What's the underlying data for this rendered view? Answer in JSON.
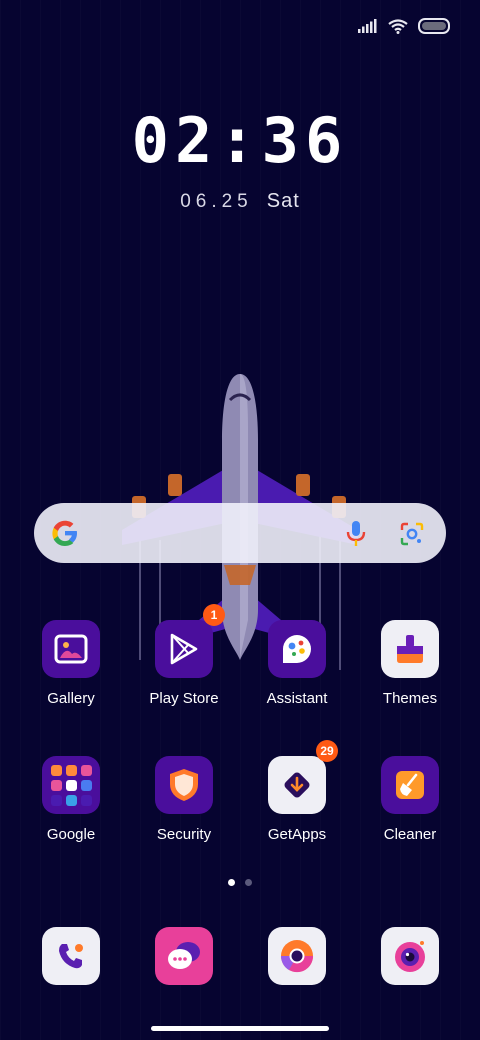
{
  "status_bar": {
    "signal_icon": "signal-bars-icon",
    "wifi_icon": "wifi-icon",
    "battery_icon": "battery-icon"
  },
  "lock": {
    "time": "02:36",
    "date": "06.25",
    "weekday": "Sat"
  },
  "search": {
    "logo_icon": "google-g-icon",
    "mic_icon": "microphone-icon",
    "lens_icon": "google-lens-icon"
  },
  "apps_row1": [
    {
      "label": "Gallery",
      "icon": "gallery-icon"
    },
    {
      "label": "Play Store",
      "icon": "play-store-icon",
      "badge": "1"
    },
    {
      "label": "Assistant",
      "icon": "assistant-icon"
    },
    {
      "label": "Themes",
      "icon": "themes-icon"
    }
  ],
  "apps_row2": [
    {
      "label": "Google",
      "icon": "google-folder-icon"
    },
    {
      "label": "Security",
      "icon": "security-shield-icon"
    },
    {
      "label": "GetApps",
      "icon": "getapps-icon",
      "badge": "29"
    },
    {
      "label": "Cleaner",
      "icon": "cleaner-broom-icon"
    }
  ],
  "dock": [
    {
      "icon": "phone-icon"
    },
    {
      "icon": "messages-icon"
    },
    {
      "icon": "chrome-icon"
    },
    {
      "icon": "camera-icon"
    }
  ],
  "page_indicator": {
    "pages": 2,
    "current": 1
  },
  "colors": {
    "background": "#060430",
    "accent_purple": "#4a0e9c",
    "badge": "#ff5a14"
  }
}
